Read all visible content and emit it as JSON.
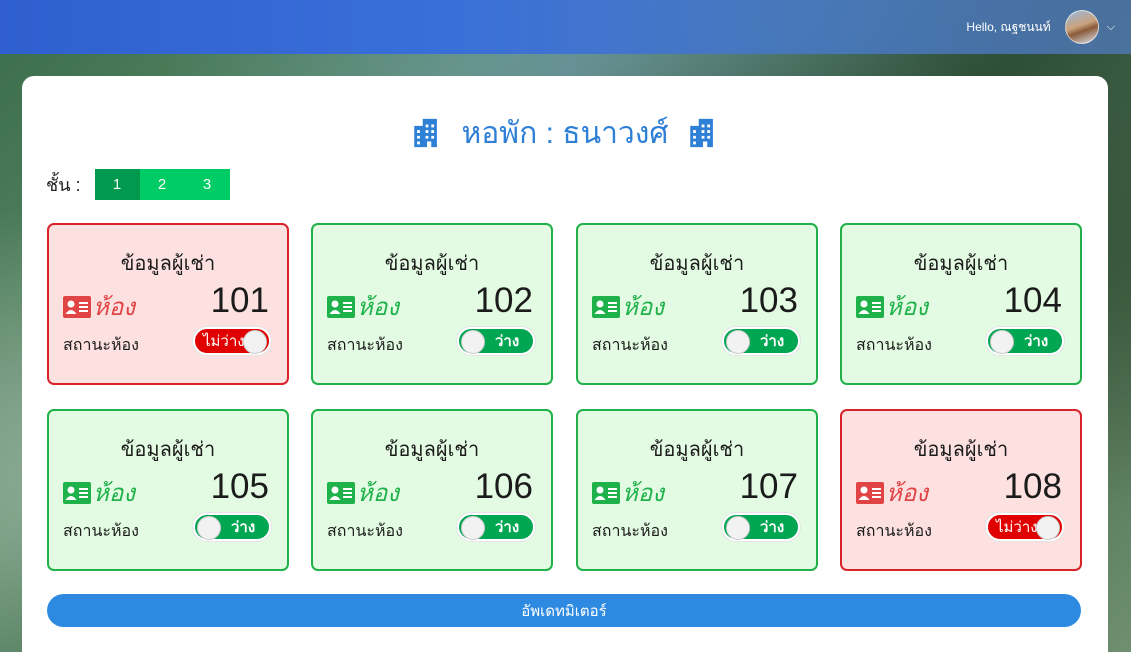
{
  "header": {
    "greeting": "Hello, ณฐชนนท์",
    "chevron": "chevron-down-icon"
  },
  "dorm": {
    "title": "หอพัก : ธนาวงศ์",
    "icon": "building-icon"
  },
  "floors": {
    "label": "ชั้น :",
    "tabs": [
      "1",
      "2",
      "3"
    ],
    "active": "1"
  },
  "room_card": {
    "heading": "ข้อมูลผู้เช่า",
    "room_word": "ห้อง",
    "status_label": "สถานะห้อง",
    "icon": "id-card-icon"
  },
  "rooms": [
    {
      "number": "101",
      "status": "ไม่ว่าง",
      "occupied": true
    },
    {
      "number": "102",
      "status": "ว่าง",
      "occupied": false
    },
    {
      "number": "103",
      "status": "ว่าง",
      "occupied": false
    },
    {
      "number": "104",
      "status": "ว่าง",
      "occupied": false
    },
    {
      "number": "105",
      "status": "ว่าง",
      "occupied": false
    },
    {
      "number": "106",
      "status": "ว่าง",
      "occupied": false
    },
    {
      "number": "107",
      "status": "ว่าง",
      "occupied": false
    },
    {
      "number": "108",
      "status": "ไม่ว่าง",
      "occupied": true
    }
  ],
  "update_button": "อัพเดทมิเตอร์",
  "colors": {
    "topbar": "#2f5fd0",
    "title": "#2e7fd6",
    "vacant_border": "#22b04a",
    "vacant_bg": "#e2fbe2",
    "occupied_border": "#d8232a",
    "occupied_bg": "#fde0e0",
    "floor_tab": "#00cc66",
    "button": "#2e8ae0"
  }
}
